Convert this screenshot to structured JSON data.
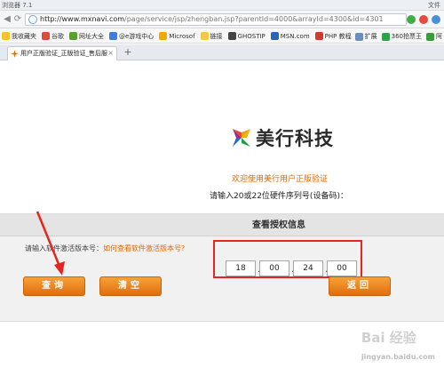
{
  "window": {
    "title_left": "浏览器 7.1",
    "title_right": "文件"
  },
  "address_bar": {
    "url_host": "http://www.mxnavi.com",
    "url_path": "/page/service/jsp/zhengban.jsp?parentId=4000&arrayId=4300&id=4301"
  },
  "bookmarks": [
    {
      "label": "我收藏夹",
      "color": "#f4c430"
    },
    {
      "label": "谷歌",
      "color": "#dd4b39"
    },
    {
      "label": "网址大全",
      "color": "#5aa02c"
    },
    {
      "label": "@e游戏中心",
      "color": "#3b7dd8"
    },
    {
      "label": "Microsof",
      "color": "#f2a900"
    },
    {
      "label": "链接",
      "color": "#f2c84b"
    },
    {
      "label": "GHOSTIP",
      "color": "#444444"
    },
    {
      "label": "MSN.com",
      "color": "#2a64b6"
    },
    {
      "label": "PHP 教程",
      "color": "#d23b2b"
    }
  ],
  "bookmarks_right": [
    {
      "label": "扩展",
      "color": "#6c8ebf"
    },
    {
      "label": "360抢票王",
      "color": "#2fa34b"
    },
    {
      "label": "阿",
      "color": "#3b9c3b"
    }
  ],
  "tab": {
    "title": "用户正版验证_正版验证_售后服"
  },
  "page": {
    "brand": "美行科技",
    "welcome": "欢迎使用美行用户正版验证",
    "prompt": "请输入20或22位硬件序列号(设备码)：",
    "panel_title": "查看授权信息",
    "serial_label": "请输入软件激活版本号：",
    "serial_link": "如何查看软件激活版本号?",
    "serial_segments": [
      "18",
      "00",
      "24",
      "00"
    ],
    "buttons": {
      "query": "查询",
      "clear": "清空",
      "back": "返回"
    }
  },
  "colors": {
    "accent": "#e06a00",
    "annotation": "#e5261f"
  },
  "watermark": {
    "text": "Bai 经验",
    "url": "jingyan.baidu.com"
  }
}
